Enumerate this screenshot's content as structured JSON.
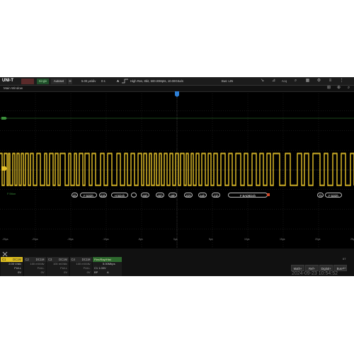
{
  "topbar": {
    "logo": "UNI-T",
    "single_label": "Single",
    "autoset_label": "Autoset",
    "h_label": "H",
    "timebase": "5.00 μs/div",
    "delay": "0 s",
    "acq_label": "A",
    "acq_info": "High Res, 8bit, 500.00Mpts, 10.00GSa/s",
    "bus_info": "Bus: LIN",
    "icons": [
      "cursor-icon",
      "measure-icon",
      "acquire-icon",
      "zoom-icon",
      "display-icon",
      "utility-icon"
    ]
  },
  "window": {
    "title": "Main Window",
    "icons": [
      "grid-icon",
      "zoom-in-icon",
      "search-icon"
    ]
  },
  "bus_tags": [
    "0h",
    "F:53Dh",
    "03h",
    "H:5D4h",
    "...",
    "55h",
    "4Eh",
    "49h",
    "2Dh",
    "54h",
    "21h",
    "F:6AD8D4h",
    "7h",
    "F:53Dh"
  ],
  "bus_marker": "F:5tion",
  "ticks": [
    "-25μs",
    "-20μs",
    "-15μs",
    "-10μs",
    "-5μs",
    "0μs",
    "5μs",
    "10μs",
    "15μs",
    "20μs",
    "25μs"
  ],
  "channels": [
    {
      "name": "C1",
      "coupling": "DC1M",
      "scale": "2.00 V/div",
      "bw": "FULL",
      "offset": "0V",
      "color": "#e0c020",
      "active": true
    },
    {
      "name": "C2",
      "coupling": "DC1M",
      "scale": "100 mV/div",
      "bw": "FULL",
      "offset": "0V",
      "color": "#555",
      "active": false
    },
    {
      "name": "C3",
      "coupling": "DC1M",
      "scale": "100 mV/div",
      "bw": "FULL",
      "offset": "0V",
      "color": "#555",
      "active": false
    },
    {
      "name": "C4",
      "coupling": "DC1M",
      "scale": "100 mV/div",
      "bw": "FULL",
      "offset": "0V",
      "color": "#555",
      "active": false
    }
  ],
  "trigger": {
    "label": "Flex/Ray/Hist",
    "rate": "5.00Mbps",
    "level": "C1 1.00V",
    "mode": "BP",
    "slope": "A"
  },
  "buttons": {
    "math": "Math+",
    "ref": "Ref+",
    "digital": "Digital+",
    "bus": "Bus+",
    "side_top": "07",
    "side_bottom": "02"
  },
  "datetime": "2024-09-23 10:54:52",
  "colors": {
    "signal": "#e6c22a",
    "bus": "#3a8f3a",
    "accent": "#2d7fd6"
  }
}
